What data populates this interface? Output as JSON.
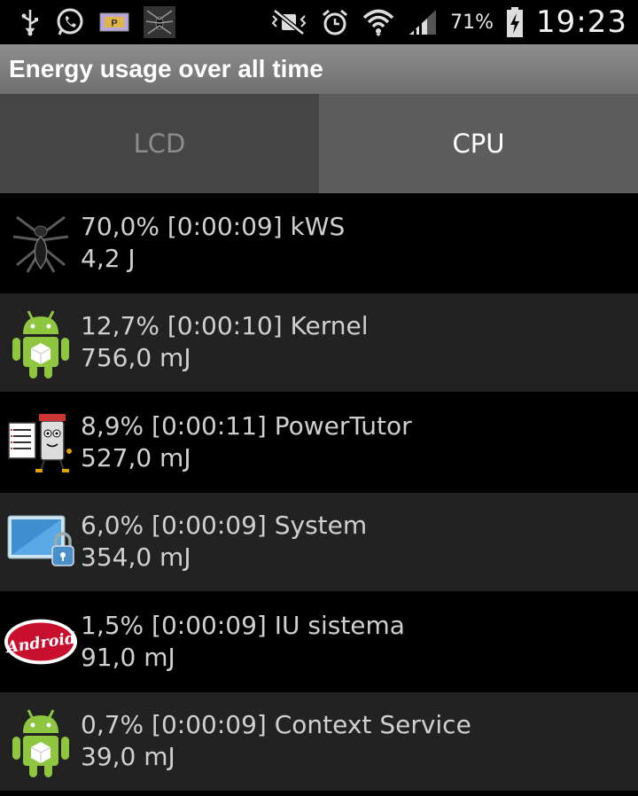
{
  "status_bar": {
    "left_icons": [
      "usb-icon",
      "whatsapp-icon",
      "parking-icon",
      "spider-app-icon"
    ],
    "right_icons": [
      "mute-vibrate-icon",
      "alarm-icon",
      "wifi-icon",
      "signal-icon",
      "battery-charging-icon"
    ],
    "battery_percent": "71%",
    "time": "19:23"
  },
  "header": {
    "title": "Energy usage over all time"
  },
  "tabs": [
    {
      "label": "LCD",
      "selected": false
    },
    {
      "label": "CPU",
      "selected": true
    }
  ],
  "apps": [
    {
      "icon": "spider-icon",
      "line1": "70,0% [0:00:09] kWS",
      "line2": "4,2 J"
    },
    {
      "icon": "android-robot-icon",
      "line1": "12,7% [0:00:10] Kernel",
      "line2": "756,0 mJ"
    },
    {
      "icon": "powertutor-icon",
      "line1": "8,9% [0:00:11] PowerTutor",
      "line2": "527,0 mJ"
    },
    {
      "icon": "system-lock-icon",
      "line1": "6,0% [0:00:09] System",
      "line2": "354,0 mJ"
    },
    {
      "icon": "android-kitkat-icon",
      "line1": "1,5% [0:00:09] IU sistema",
      "line2": "91,0 mJ"
    },
    {
      "icon": "android-robot-icon",
      "line1": "0,7% [0:00:09] Context Service",
      "line2": "39,0 mJ"
    }
  ],
  "colors": {
    "title_bar": "#7d7d7d",
    "tab_selected": "#5d5d5d",
    "tab_unselected": "#454545",
    "row_alt": "#222222",
    "android_green": "#8fc63f"
  }
}
